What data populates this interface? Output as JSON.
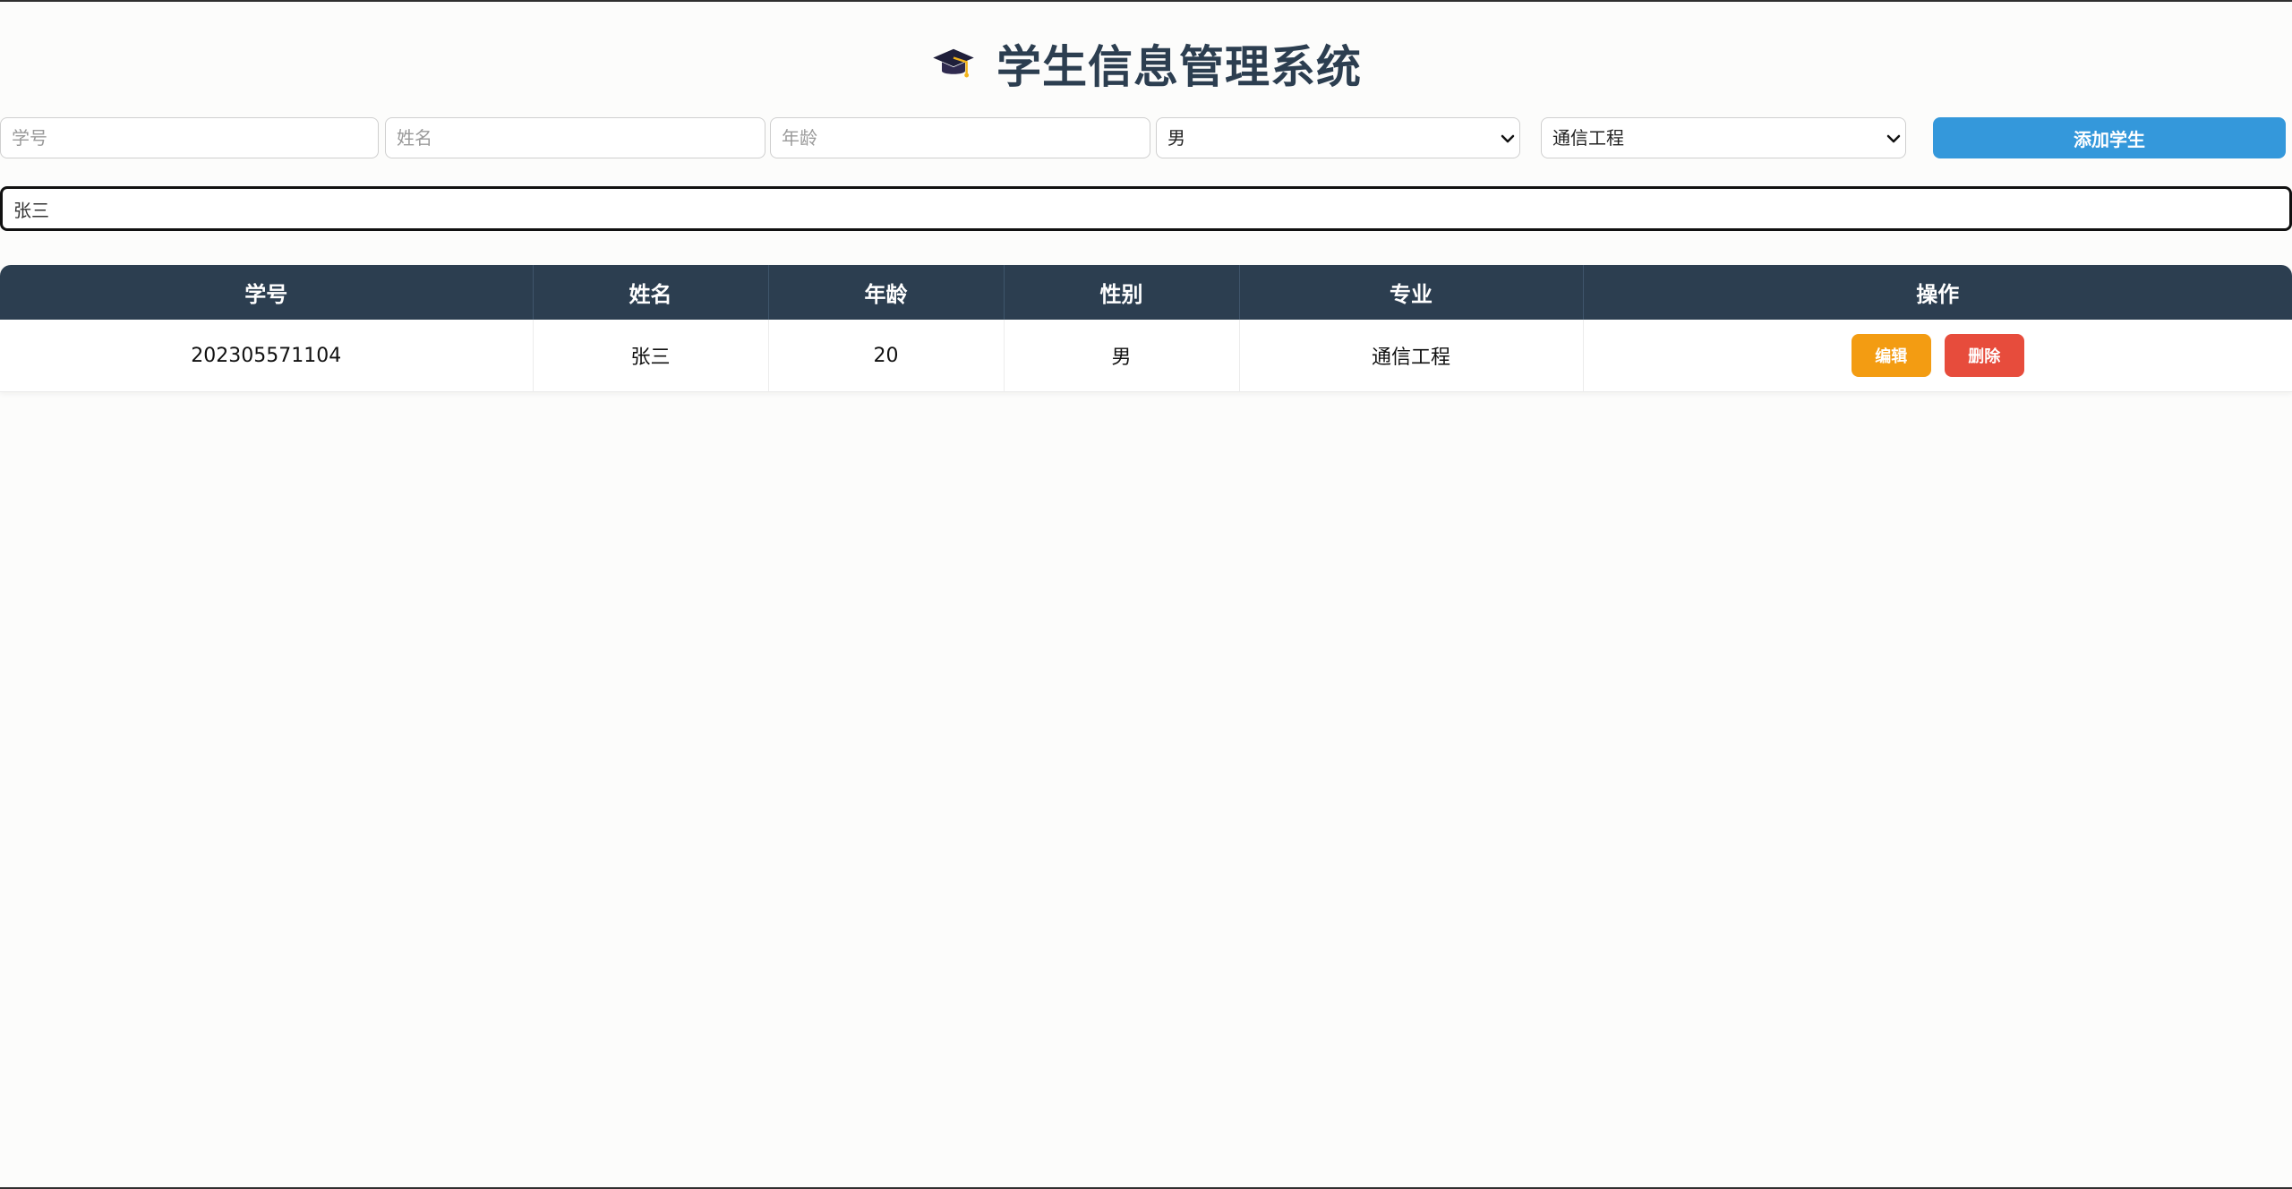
{
  "header": {
    "title": "学生信息管理系统",
    "icon": "graduation-cap-icon"
  },
  "form": {
    "student_id_placeholder": "学号",
    "name_placeholder": "姓名",
    "age_placeholder": "年龄",
    "gender_selected": "男",
    "major_selected": "通信工程",
    "add_button_label": "添加学生"
  },
  "search": {
    "value": "张三"
  },
  "table": {
    "headers": [
      "学号",
      "姓名",
      "年龄",
      "性别",
      "专业",
      "操作"
    ],
    "rows": [
      {
        "student_id": "202305571104",
        "name": "张三",
        "age": "20",
        "gender": "男",
        "major": "通信工程",
        "edit_label": "编辑",
        "delete_label": "删除"
      }
    ]
  },
  "colors": {
    "header_bg": "#2c3e50",
    "primary": "#3498db",
    "edit": "#f39c12",
    "delete": "#e74c3c"
  }
}
